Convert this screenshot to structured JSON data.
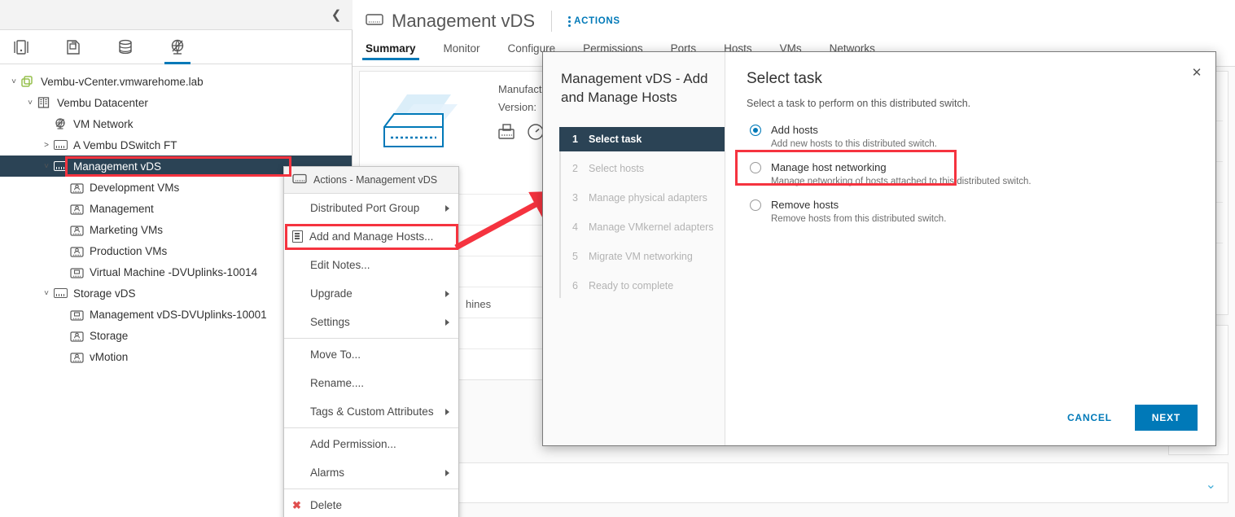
{
  "left_panel": {
    "collapse_icon": "chevron-left-icon",
    "inventory_icons": [
      {
        "name": "hosts-and-clusters-icon",
        "active": false
      },
      {
        "name": "vms-and-templates-icon",
        "active": false
      },
      {
        "name": "storage-icon",
        "active": false
      },
      {
        "name": "networking-icon",
        "active": true
      }
    ],
    "tree": [
      {
        "label": "Vembu-vCenter.vmwarehome.lab",
        "indent": 0,
        "twisty": "v",
        "icon": "vcenter-icon",
        "selected": false
      },
      {
        "label": "Vembu Datacenter",
        "indent": 1,
        "twisty": "v",
        "icon": "datacenter-icon",
        "selected": false
      },
      {
        "label": "VM Network",
        "indent": 2,
        "twisty": "",
        "icon": "network-icon",
        "selected": false
      },
      {
        "label": "A Vembu DSwitch FT",
        "indent": 2,
        "twisty": ">",
        "icon": "dswitch-icon",
        "selected": false
      },
      {
        "label": "Management vDS",
        "indent": 2,
        "twisty": "v",
        "icon": "dswitch-icon",
        "selected": true
      },
      {
        "label": "Development VMs",
        "indent": 3,
        "twisty": "",
        "icon": "portgroup-icon",
        "selected": false
      },
      {
        "label": "Management",
        "indent": 3,
        "twisty": "",
        "icon": "portgroup-icon",
        "selected": false
      },
      {
        "label": "Marketing VMs",
        "indent": 3,
        "twisty": "",
        "icon": "portgroup-icon",
        "selected": false
      },
      {
        "label": "Production VMs",
        "indent": 3,
        "twisty": "",
        "icon": "portgroup-icon",
        "selected": false
      },
      {
        "label": "Virtual Machine -DVUplinks-10014",
        "indent": 3,
        "twisty": "",
        "icon": "uplink-portgroup-icon",
        "selected": false
      },
      {
        "label": "Storage vDS",
        "indent": 2,
        "twisty": "v",
        "icon": "dswitch-icon",
        "selected": false
      },
      {
        "label": "Management vDS-DVUplinks-10001",
        "indent": 3,
        "twisty": "",
        "icon": "uplink-portgroup-icon",
        "selected": false
      },
      {
        "label": "Storage",
        "indent": 3,
        "twisty": "",
        "icon": "portgroup-icon",
        "selected": false
      },
      {
        "label": "vMotion",
        "indent": 3,
        "twisty": "",
        "icon": "portgroup-icon",
        "selected": false
      }
    ]
  },
  "header": {
    "object_icon": "dswitch-icon",
    "title": "Management vDS",
    "actions_label": "ACTIONS",
    "actions_icon": "kebab-menu-icon"
  },
  "tabs": [
    {
      "label": "Summary",
      "active": true
    },
    {
      "label": "Monitor",
      "active": false
    },
    {
      "label": "Configure",
      "active": false
    },
    {
      "label": "Permissions",
      "active": false
    },
    {
      "label": "Ports",
      "active": false
    },
    {
      "label": "Hosts",
      "active": false
    },
    {
      "label": "VMs",
      "active": false
    },
    {
      "label": "Networks",
      "active": false
    }
  ],
  "summary": {
    "manufacturer_label": "Manufacturer:",
    "version_label": "Version:",
    "vds_art_icon": "distributed-switch-illustration",
    "related_icon_1": "packages-icon",
    "related_icon_2": "gauge-icon",
    "virtual_machines_fragment": "hines"
  },
  "bottom_panel": {
    "chevron_icon": "chevron-down-icon"
  },
  "context_menu": {
    "header_label": "Actions - Management vDS",
    "header_icon": "dswitch-icon",
    "items": [
      {
        "label": "Distributed Port Group",
        "submenu": true,
        "icon": "",
        "sep_after": false
      },
      {
        "label": "Add and Manage Hosts...",
        "submenu": false,
        "icon": "add-manage-hosts-icon",
        "sep_after": false,
        "highlighted": true
      },
      {
        "label": "Edit Notes...",
        "submenu": false,
        "icon": "",
        "sep_after": false
      },
      {
        "label": "Upgrade",
        "submenu": true,
        "icon": "",
        "sep_after": false
      },
      {
        "label": "Settings",
        "submenu": true,
        "icon": "",
        "sep_after": true
      },
      {
        "label": "Move To...",
        "submenu": false,
        "icon": "",
        "sep_after": false
      },
      {
        "label": "Rename....",
        "submenu": false,
        "icon": "",
        "sep_after": false
      },
      {
        "label": "Tags & Custom Attributes",
        "submenu": true,
        "icon": "",
        "sep_after": true
      },
      {
        "label": "Add Permission...",
        "submenu": false,
        "icon": "",
        "sep_after": false
      },
      {
        "label": "Alarms",
        "submenu": true,
        "icon": "",
        "sep_after": true
      },
      {
        "label": "Delete",
        "submenu": false,
        "icon": "delete-icon",
        "sep_after": false
      }
    ]
  },
  "dialog": {
    "title": "Management vDS - Add and Manage Hosts",
    "close_icon": "close-icon",
    "steps": [
      {
        "num": "1",
        "label": "Select task",
        "active": true
      },
      {
        "num": "2",
        "label": "Select hosts",
        "active": false
      },
      {
        "num": "3",
        "label": "Manage physical adapters",
        "active": false
      },
      {
        "num": "4",
        "label": "Manage VMkernel adapters",
        "active": false
      },
      {
        "num": "5",
        "label": "Migrate VM networking",
        "active": false
      },
      {
        "num": "6",
        "label": "Ready to complete",
        "active": false
      }
    ],
    "heading": "Select task",
    "subheading": "Select a task to perform on this distributed switch.",
    "options": [
      {
        "label": "Add hosts",
        "desc": "Add new hosts to this distributed switch.",
        "checked": true,
        "highlighted": false
      },
      {
        "label": "Manage host networking",
        "desc": "Manage networking of hosts attached to this distributed switch.",
        "checked": false,
        "highlighted": true
      },
      {
        "label": "Remove hosts",
        "desc": "Remove hosts from this distributed switch.",
        "checked": false,
        "highlighted": false
      }
    ],
    "cancel_label": "CANCEL",
    "next_label": "NEXT"
  },
  "annotations": {
    "accent_color": "#f5333f",
    "arrow_icon": "red-arrow-pointing-up-right"
  },
  "colors": {
    "selected_row": "#2b4355",
    "primary_blue": "#0079b8",
    "link_blue": "#49afd9"
  }
}
